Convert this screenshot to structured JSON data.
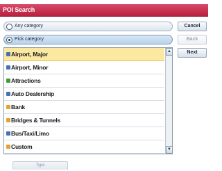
{
  "window": {
    "title": "POI Search"
  },
  "options": [
    {
      "label": "Any category",
      "selected": false
    },
    {
      "label": "Pick category",
      "selected": true
    }
  ],
  "buttons": {
    "cancel": "Cancel",
    "back": "Back",
    "next": "Next",
    "type": "Type"
  },
  "categories": [
    {
      "label": "Airport, Major",
      "icon": "airport-major-icon",
      "color": "#4a6fb5",
      "selected": true
    },
    {
      "label": "Airport, Minor",
      "icon": "airport-minor-icon",
      "color": "#4a6fb5",
      "selected": false
    },
    {
      "label": "Attractions",
      "icon": "attractions-icon",
      "color": "#3f9a3c",
      "selected": false
    },
    {
      "label": "Auto Dealership",
      "icon": "auto-dealership-icon",
      "color": "#4a6fb5",
      "selected": false
    },
    {
      "label": "Bank",
      "icon": "bank-icon",
      "color": "#e0a23a",
      "selected": false
    },
    {
      "label": "Bridges & Tunnels",
      "icon": "bridges-tunnels-icon",
      "color": "#e0a23a",
      "selected": false
    },
    {
      "label": "Bus/Taxi/Limo",
      "icon": "bus-taxi-limo-icon",
      "color": "#4a6fb5",
      "selected": false
    },
    {
      "label": "Custom",
      "icon": "custom-icon",
      "color": "#e0a23a",
      "selected": false
    }
  ],
  "scroll": {
    "up_icon": "scroll-up-arrow-icon",
    "down_icon": "scroll-down-arrow-icon"
  },
  "colors": {
    "titlebar": "#c2284a",
    "selected_row": "#fbe9a2",
    "option_selected": "#c7dcf0"
  }
}
